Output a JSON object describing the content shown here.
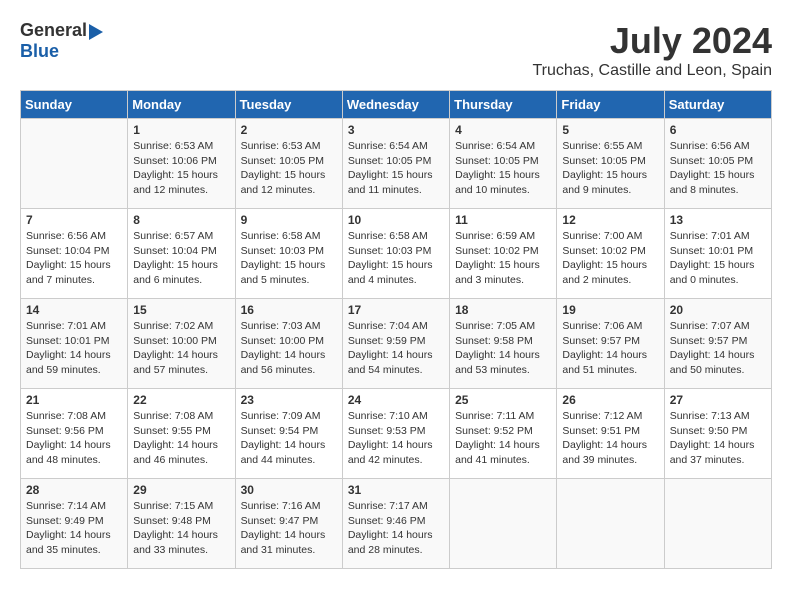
{
  "header": {
    "logo_general": "General",
    "logo_blue": "Blue",
    "month_year": "July 2024",
    "location": "Truchas, Castille and Leon, Spain"
  },
  "days_of_week": [
    "Sunday",
    "Monday",
    "Tuesday",
    "Wednesday",
    "Thursday",
    "Friday",
    "Saturday"
  ],
  "weeks": [
    [
      {
        "day": "",
        "info": ""
      },
      {
        "day": "1",
        "info": "Sunrise: 6:53 AM\nSunset: 10:06 PM\nDaylight: 15 hours\nand 12 minutes."
      },
      {
        "day": "2",
        "info": "Sunrise: 6:53 AM\nSunset: 10:05 PM\nDaylight: 15 hours\nand 12 minutes."
      },
      {
        "day": "3",
        "info": "Sunrise: 6:54 AM\nSunset: 10:05 PM\nDaylight: 15 hours\nand 11 minutes."
      },
      {
        "day": "4",
        "info": "Sunrise: 6:54 AM\nSunset: 10:05 PM\nDaylight: 15 hours\nand 10 minutes."
      },
      {
        "day": "5",
        "info": "Sunrise: 6:55 AM\nSunset: 10:05 PM\nDaylight: 15 hours\nand 9 minutes."
      },
      {
        "day": "6",
        "info": "Sunrise: 6:56 AM\nSunset: 10:05 PM\nDaylight: 15 hours\nand 8 minutes."
      }
    ],
    [
      {
        "day": "7",
        "info": "Sunrise: 6:56 AM\nSunset: 10:04 PM\nDaylight: 15 hours\nand 7 minutes."
      },
      {
        "day": "8",
        "info": "Sunrise: 6:57 AM\nSunset: 10:04 PM\nDaylight: 15 hours\nand 6 minutes."
      },
      {
        "day": "9",
        "info": "Sunrise: 6:58 AM\nSunset: 10:03 PM\nDaylight: 15 hours\nand 5 minutes."
      },
      {
        "day": "10",
        "info": "Sunrise: 6:58 AM\nSunset: 10:03 PM\nDaylight: 15 hours\nand 4 minutes."
      },
      {
        "day": "11",
        "info": "Sunrise: 6:59 AM\nSunset: 10:02 PM\nDaylight: 15 hours\nand 3 minutes."
      },
      {
        "day": "12",
        "info": "Sunrise: 7:00 AM\nSunset: 10:02 PM\nDaylight: 15 hours\nand 2 minutes."
      },
      {
        "day": "13",
        "info": "Sunrise: 7:01 AM\nSunset: 10:01 PM\nDaylight: 15 hours\nand 0 minutes."
      }
    ],
    [
      {
        "day": "14",
        "info": "Sunrise: 7:01 AM\nSunset: 10:01 PM\nDaylight: 14 hours\nand 59 minutes."
      },
      {
        "day": "15",
        "info": "Sunrise: 7:02 AM\nSunset: 10:00 PM\nDaylight: 14 hours\nand 57 minutes."
      },
      {
        "day": "16",
        "info": "Sunrise: 7:03 AM\nSunset: 10:00 PM\nDaylight: 14 hours\nand 56 minutes."
      },
      {
        "day": "17",
        "info": "Sunrise: 7:04 AM\nSunset: 9:59 PM\nDaylight: 14 hours\nand 54 minutes."
      },
      {
        "day": "18",
        "info": "Sunrise: 7:05 AM\nSunset: 9:58 PM\nDaylight: 14 hours\nand 53 minutes."
      },
      {
        "day": "19",
        "info": "Sunrise: 7:06 AM\nSunset: 9:57 PM\nDaylight: 14 hours\nand 51 minutes."
      },
      {
        "day": "20",
        "info": "Sunrise: 7:07 AM\nSunset: 9:57 PM\nDaylight: 14 hours\nand 50 minutes."
      }
    ],
    [
      {
        "day": "21",
        "info": "Sunrise: 7:08 AM\nSunset: 9:56 PM\nDaylight: 14 hours\nand 48 minutes."
      },
      {
        "day": "22",
        "info": "Sunrise: 7:08 AM\nSunset: 9:55 PM\nDaylight: 14 hours\nand 46 minutes."
      },
      {
        "day": "23",
        "info": "Sunrise: 7:09 AM\nSunset: 9:54 PM\nDaylight: 14 hours\nand 44 minutes."
      },
      {
        "day": "24",
        "info": "Sunrise: 7:10 AM\nSunset: 9:53 PM\nDaylight: 14 hours\nand 42 minutes."
      },
      {
        "day": "25",
        "info": "Sunrise: 7:11 AM\nSunset: 9:52 PM\nDaylight: 14 hours\nand 41 minutes."
      },
      {
        "day": "26",
        "info": "Sunrise: 7:12 AM\nSunset: 9:51 PM\nDaylight: 14 hours\nand 39 minutes."
      },
      {
        "day": "27",
        "info": "Sunrise: 7:13 AM\nSunset: 9:50 PM\nDaylight: 14 hours\nand 37 minutes."
      }
    ],
    [
      {
        "day": "28",
        "info": "Sunrise: 7:14 AM\nSunset: 9:49 PM\nDaylight: 14 hours\nand 35 minutes."
      },
      {
        "day": "29",
        "info": "Sunrise: 7:15 AM\nSunset: 9:48 PM\nDaylight: 14 hours\nand 33 minutes."
      },
      {
        "day": "30",
        "info": "Sunrise: 7:16 AM\nSunset: 9:47 PM\nDaylight: 14 hours\nand 31 minutes."
      },
      {
        "day": "31",
        "info": "Sunrise: 7:17 AM\nSunset: 9:46 PM\nDaylight: 14 hours\nand 28 minutes."
      },
      {
        "day": "",
        "info": ""
      },
      {
        "day": "",
        "info": ""
      },
      {
        "day": "",
        "info": ""
      }
    ]
  ]
}
